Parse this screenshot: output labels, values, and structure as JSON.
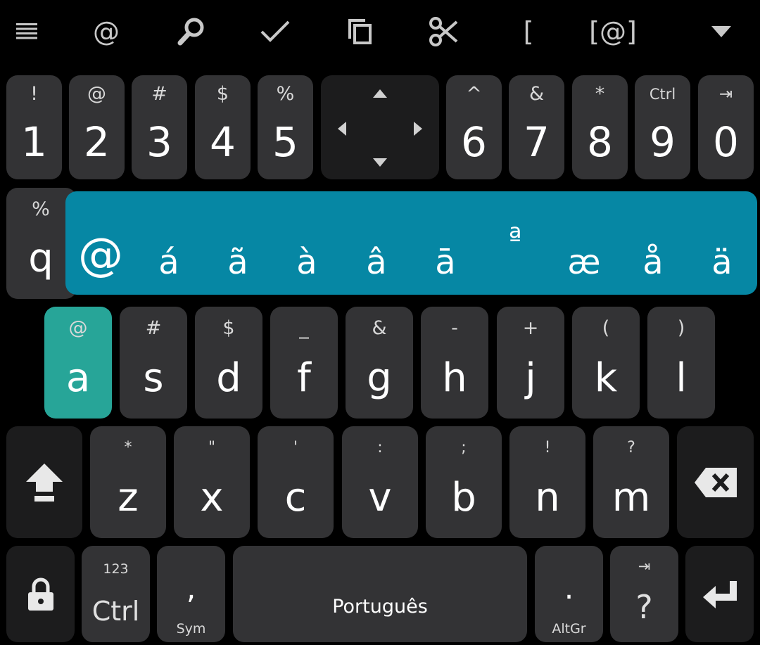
{
  "toolbar": {
    "items": [
      {
        "name": "menu-icon"
      },
      {
        "name": "at-icon",
        "label": "@"
      },
      {
        "name": "search-icon"
      },
      {
        "name": "check-icon"
      },
      {
        "name": "copy-icon"
      },
      {
        "name": "cut-icon"
      },
      {
        "name": "bracket-icon",
        "label": "["
      },
      {
        "name": "at-bracket-icon",
        "label": "[@]"
      },
      {
        "name": "collapse-icon"
      }
    ]
  },
  "row1": {
    "keys": [
      {
        "hint": "!",
        "main": "1"
      },
      {
        "hint": "@",
        "main": "2"
      },
      {
        "hint": "#",
        "main": "3"
      },
      {
        "hint": "$",
        "main": "4"
      },
      {
        "hint": "%",
        "main": "5"
      },
      {
        "hint": "^",
        "main": "6"
      },
      {
        "hint": "&",
        "main": "7"
      },
      {
        "hint": "*",
        "main": "8"
      },
      {
        "hint": "Ctrl",
        "main": "9"
      },
      {
        "hint": "⇥",
        "main": "0"
      }
    ]
  },
  "row2": {
    "q": {
      "hint": "%",
      "main": "q"
    },
    "popup_chars": [
      "@",
      "á",
      "ã",
      "à",
      "â",
      "ā",
      "ª",
      "æ",
      "å",
      "ä"
    ]
  },
  "row3": {
    "keys": [
      {
        "hint": "@",
        "main": "a"
      },
      {
        "hint": "#",
        "main": "s"
      },
      {
        "hint": "$",
        "main": "d"
      },
      {
        "hint": "_",
        "main": "f"
      },
      {
        "hint": "&",
        "main": "g"
      },
      {
        "hint": "-",
        "main": "h"
      },
      {
        "hint": "+",
        "main": "j"
      },
      {
        "hint": "(",
        "main": "k"
      },
      {
        "hint": ")",
        "main": "l"
      }
    ]
  },
  "row4": {
    "keys": [
      {
        "hint": "*",
        "main": "z"
      },
      {
        "hint": "\"",
        "main": "x"
      },
      {
        "hint": "'",
        "main": "c"
      },
      {
        "hint": ":",
        "main": "v"
      },
      {
        "hint": ";",
        "main": "b"
      },
      {
        "hint": "!",
        "main": "n"
      },
      {
        "hint": "?",
        "main": "m"
      }
    ]
  },
  "row5": {
    "ctrl": {
      "hint": "123",
      "main": "Ctrl"
    },
    "comma": {
      "main": ",",
      "sub": "Sym"
    },
    "space": {
      "label": "Português"
    },
    "period": {
      "main": ".",
      "sub": "AltGr"
    },
    "question": {
      "hint": "⇥",
      "main": "?"
    }
  },
  "colors": {
    "key": "#333335",
    "popup": "#0687a4",
    "active": "#27a598",
    "background": "#000000"
  }
}
